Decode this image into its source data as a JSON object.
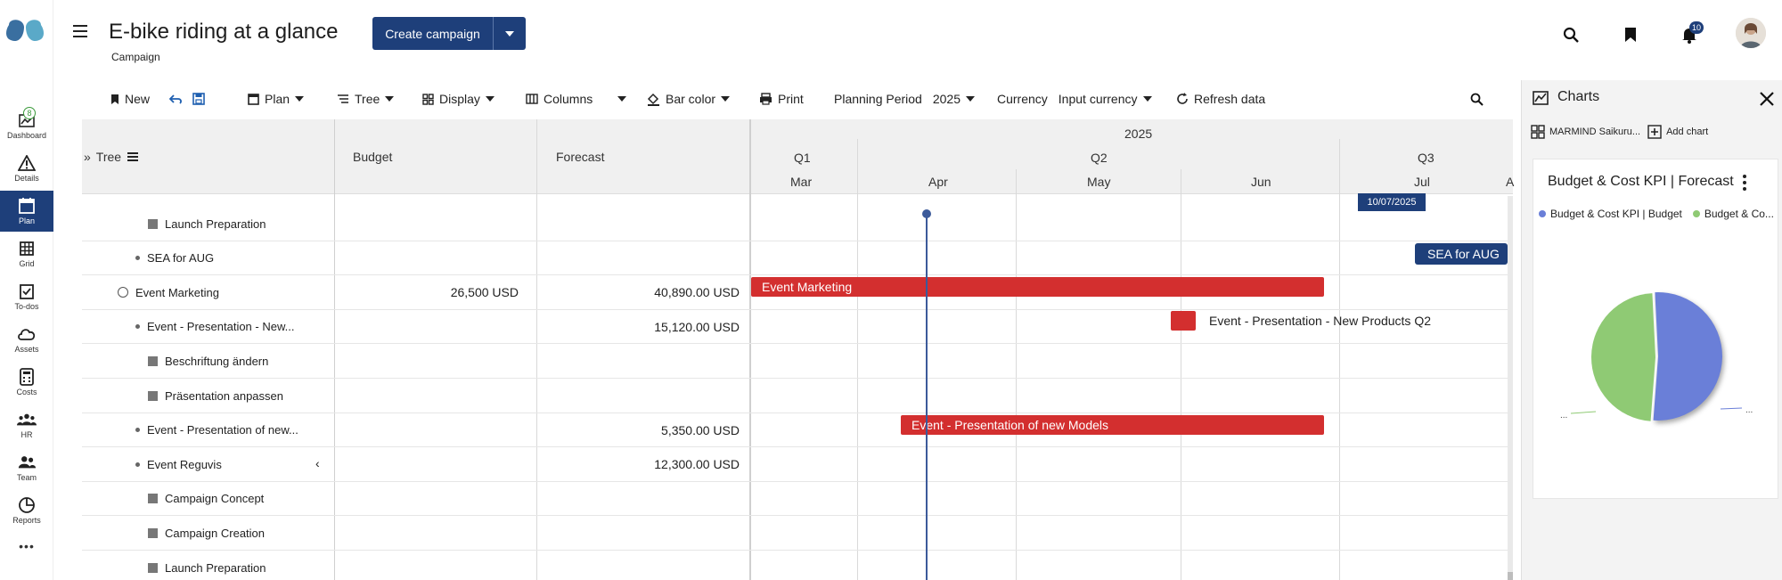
{
  "header": {
    "title": "E-bike riding at a glance",
    "subtitle": "Campaign",
    "create_button": "Create campaign",
    "notification_count": "10"
  },
  "sidebar": {
    "items": [
      {
        "label": "Dashboard",
        "icon": "dashboard-icon",
        "badge": "8"
      },
      {
        "label": "Details",
        "icon": "warning-triangle-icon"
      },
      {
        "label": "Plan",
        "icon": "calendar-icon",
        "active": true
      },
      {
        "label": "Grid",
        "icon": "grid-icon"
      },
      {
        "label": "To-dos",
        "icon": "todo-icon"
      },
      {
        "label": "Assets",
        "icon": "cloud-icon"
      },
      {
        "label": "Costs",
        "icon": "calculator-icon"
      },
      {
        "label": "HR",
        "icon": "people-icon"
      },
      {
        "label": "Team",
        "icon": "team-icon"
      },
      {
        "label": "Reports",
        "icon": "reports-icon"
      }
    ],
    "more": "•••"
  },
  "toolbar": {
    "new": "New",
    "plan": "Plan",
    "tree": "Tree",
    "display": "Display",
    "columns": "Columns",
    "bar_color": "Bar color",
    "print": "Print",
    "planning_period_label": "Planning Period",
    "planning_period_value": "2025",
    "currency_label": "Currency",
    "currency_value": "Input currency",
    "refresh": "Refresh data"
  },
  "grid": {
    "tree_header": "Tree",
    "budget_header": "Budget",
    "forecast_header": "Forecast",
    "year": "2025",
    "quarters": [
      "Q1",
      "Q2",
      "Q3"
    ],
    "months": [
      "Mar",
      "Apr",
      "May",
      "Jun",
      "Jul",
      "A"
    ],
    "today_label": "10/07/2025",
    "rows": [
      {
        "name": "Launch Preparation",
        "marker": "box",
        "indent": 2,
        "budget": "",
        "forecast": ""
      },
      {
        "name": "SEA for AUG",
        "marker": "dot",
        "indent": 1,
        "budget": "",
        "forecast": ""
      },
      {
        "name": "Event Marketing",
        "marker": "circle",
        "indent": 0,
        "budget": "26,500 USD",
        "forecast": "40,890.00 USD"
      },
      {
        "name": "Event - Presentation - New...",
        "marker": "dot",
        "indent": 1,
        "budget": "",
        "forecast": "15,120.00 USD"
      },
      {
        "name": "Beschriftung ändern",
        "marker": "box",
        "indent": 2,
        "budget": "",
        "forecast": ""
      },
      {
        "name": "Präsentation anpassen",
        "marker": "box",
        "indent": 2,
        "budget": "",
        "forecast": ""
      },
      {
        "name": "Event - Presentation of new...",
        "marker": "dot",
        "indent": 1,
        "budget": "",
        "forecast": "5,350.00 USD"
      },
      {
        "name": "Event Reguvis",
        "marker": "dot",
        "indent": 1,
        "budget": "",
        "forecast": "12,300.00 USD"
      },
      {
        "name": "Campaign Concept",
        "marker": "box",
        "indent": 2,
        "budget": "",
        "forecast": ""
      },
      {
        "name": "Campaign Creation",
        "marker": "box",
        "indent": 2,
        "budget": "",
        "forecast": ""
      },
      {
        "name": "Launch Preparation",
        "marker": "box",
        "indent": 2,
        "budget": "",
        "forecast": ""
      }
    ],
    "bars": [
      {
        "label": "SEA for AUG",
        "color": "#1e3f7a"
      },
      {
        "label": "Event Marketing",
        "color": "#d32f2f"
      },
      {
        "label": "Event - Presentation - New Products Q2",
        "color": "#d32f2f"
      },
      {
        "label": "Event - Presentation of new Models",
        "color": "#d32f2f"
      }
    ]
  },
  "charts": {
    "panel_title": "Charts",
    "source": "MARMIND Saikuru...",
    "add_chart": "Add chart",
    "card_title": "Budget & Cost KPI | Forecast",
    "legend": [
      {
        "label": "Budget & Cost KPI | Budget",
        "color": "#6a7fd8"
      },
      {
        "label": "Budget & Co...",
        "color": "#8fca74"
      }
    ],
    "pie_leader_left": "...",
    "pie_leader_right": "..."
  },
  "chart_data": {
    "type": "pie",
    "title": "Budget & Cost KPI | Forecast",
    "labels": [
      "Budget & Cost KPI | Budget",
      "Budget & Co..."
    ],
    "values": [
      52,
      48
    ],
    "colors": [
      "#6a7fd8",
      "#8fca74"
    ]
  }
}
